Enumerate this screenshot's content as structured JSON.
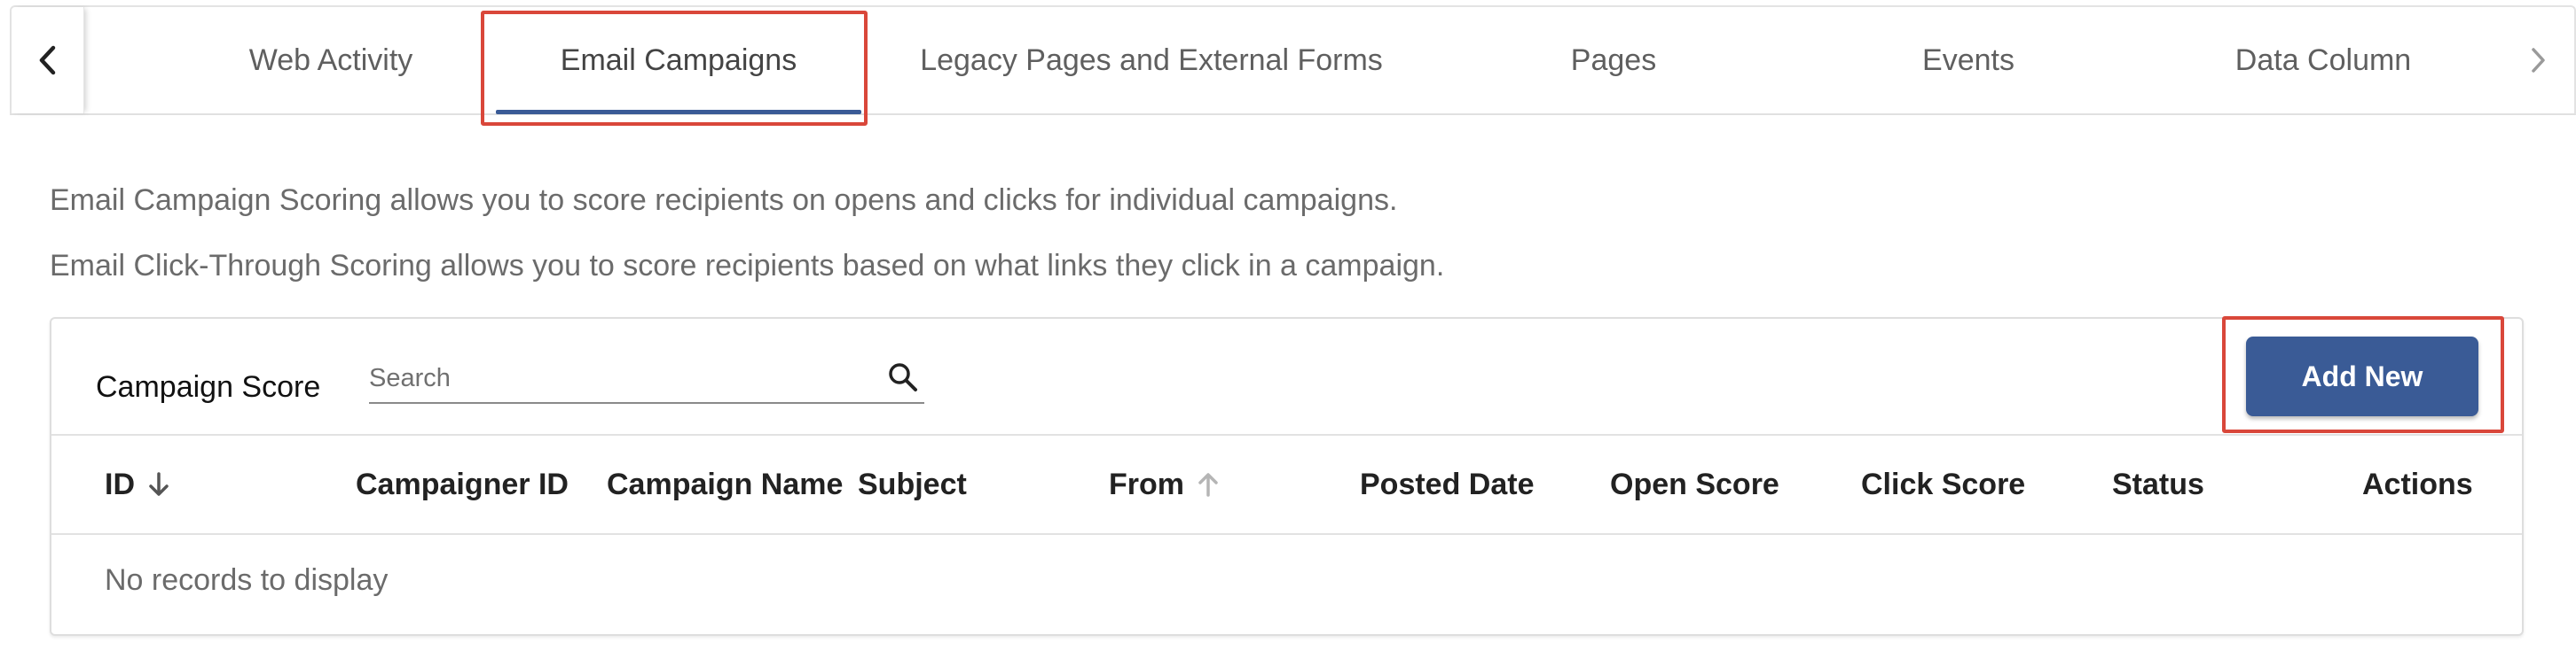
{
  "tabs": [
    {
      "label": "Web Activity",
      "active": false
    },
    {
      "label": "Email Campaigns",
      "active": true
    },
    {
      "label": "Legacy Pages and External Forms",
      "active": false
    },
    {
      "label": "Pages",
      "active": false
    },
    {
      "label": "Events",
      "active": false
    },
    {
      "label": "Data Column",
      "active": false
    }
  ],
  "nav": {
    "prev_icon": "chevron-left-icon",
    "next_icon": "chevron-right-icon"
  },
  "descriptions": {
    "campaign_scoring": "Email Campaign Scoring allows you to score recipients on opens and clicks for individual campaigns.",
    "click_through": "Email Click-Through Scoring allows you to score recipients based on what links they click in a campaign."
  },
  "panel": {
    "title": "Campaign Score",
    "search": {
      "placeholder": "Search",
      "value": ""
    },
    "add_label": "Add New",
    "columns": [
      {
        "label": "ID",
        "sort": "desc"
      },
      {
        "label": "Campaigner ID",
        "sort": null
      },
      {
        "label": "Campaign Name",
        "sort": null
      },
      {
        "label": "Subject",
        "sort": null
      },
      {
        "label": "From",
        "sort": "asc"
      },
      {
        "label": "Posted Date",
        "sort": null
      },
      {
        "label": "Open Score",
        "sort": null
      },
      {
        "label": "Click Score",
        "sort": null
      },
      {
        "label": "Status",
        "sort": null
      },
      {
        "label": "Actions",
        "sort": null
      }
    ],
    "empty_message": "No records to display"
  },
  "colors": {
    "accent": "#3a5b96",
    "highlight": "#d9473a",
    "muted_text": "#6b6b6b"
  }
}
